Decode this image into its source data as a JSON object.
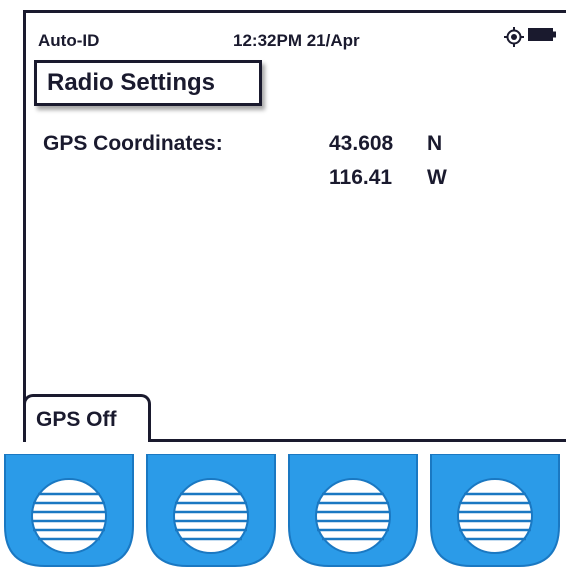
{
  "status_bar": {
    "app_name": "Auto-ID",
    "time_date": "12:32PM 21/Apr",
    "icons": [
      "gps-target-icon",
      "battery-icon"
    ]
  },
  "screen": {
    "title": "Radio Settings",
    "gps_label": "GPS Coordinates:",
    "latitude": {
      "value": "43.608",
      "direction": "N"
    },
    "longitude": {
      "value": "116.41",
      "direction": "W"
    }
  },
  "softkeys": {
    "tab_label": "GPS Off",
    "buttons": [
      "softkey-1",
      "softkey-2",
      "softkey-3",
      "softkey-4"
    ]
  },
  "colors": {
    "text": "#1a1a2e",
    "softkey_blue": "#2b9be8",
    "softkey_blue_dark": "#1a78c2"
  }
}
